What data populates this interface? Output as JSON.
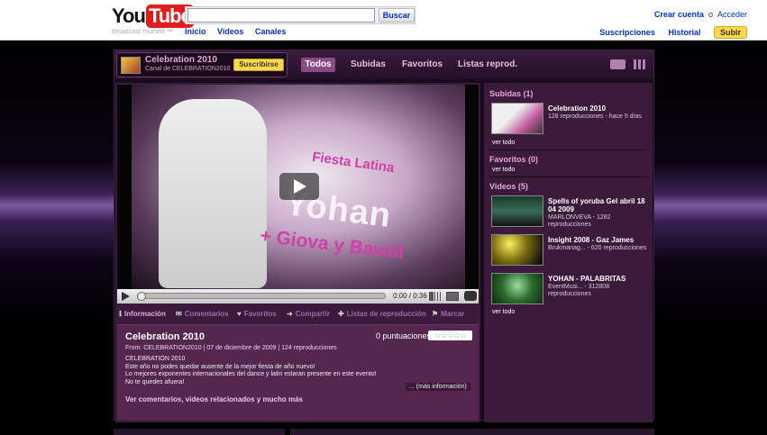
{
  "header": {
    "logo_you": "You",
    "logo_tube": "Tube",
    "tagline": "Broadcast Yourself ™",
    "search_placeholder": "",
    "search_button": "Buscar",
    "nav": [
      "Inicio",
      "Videos",
      "Canales"
    ],
    "create_account": "Crear cuenta",
    "or": "o",
    "login": "Acceder",
    "subscriptions": "Suscripciones",
    "history": "Historial",
    "upload": "Subir"
  },
  "channel": {
    "title": "Celebration 2010",
    "subtitle": "Canal de CELEBRATION2010",
    "subscribe": "Suscribirse",
    "tabs": [
      "Todos",
      "Subidas",
      "Favoritos",
      "Listas reprod."
    ],
    "active_tab": "Todos"
  },
  "player": {
    "overlay_line1": "Fiesta Latina",
    "overlay_line2": "Yohan",
    "overlay_line3": "+ Giova y Bawill",
    "time": "0:00 / 0:36",
    "progress": 0
  },
  "actions": {
    "info": "Información",
    "comments": "Comentarios",
    "favorites": "Favoritos",
    "share": "Compartir",
    "playlists": "Listas de reproducción",
    "flag": "Marcar"
  },
  "video_info": {
    "title": "Celebration 2010",
    "meta": "From: CELEBRATION2010 | 07 de diciembre de 2009 | 124 reproducciones",
    "ratings": "0 puntuaciones",
    "stars": "☆☆☆☆☆",
    "description": [
      "CELEBRATION 2010",
      "Este año no podes quedar ausente de la mejor fiesta de año nuevo!",
      "Lo mejores exponentes internacionales del dance y latin estaran presente en este evento!",
      "No te quedes afuera!"
    ],
    "more_info": "... (más información)",
    "see_all": "Ver comentarios, videos relacionados y mucho más"
  },
  "sidebar": {
    "uploads_header": "Subidas (1)",
    "uploads": [
      {
        "title": "Celebration 2010",
        "sub": "128 reproducciones - hace 5 días"
      }
    ],
    "uploads_see_all": "ver todo",
    "favorites_header": "Favoritos (0)",
    "favorites_see_all": "ver todo",
    "videos_header": "Videos (5)",
    "videos": [
      {
        "title": "Spells of yoruba Gel abril 18 04 2009",
        "sub": "MARLONVEVA - 1282 reproducciones"
      },
      {
        "title": "Insight 2008 - Gaz James",
        "sub": "Brukmanag... - 620 reproducciones"
      },
      {
        "title": "YOHAN - PALABRITAS",
        "sub": "EventMusi... - 312808 reproducciones"
      }
    ],
    "videos_see_all": "ver todo"
  }
}
